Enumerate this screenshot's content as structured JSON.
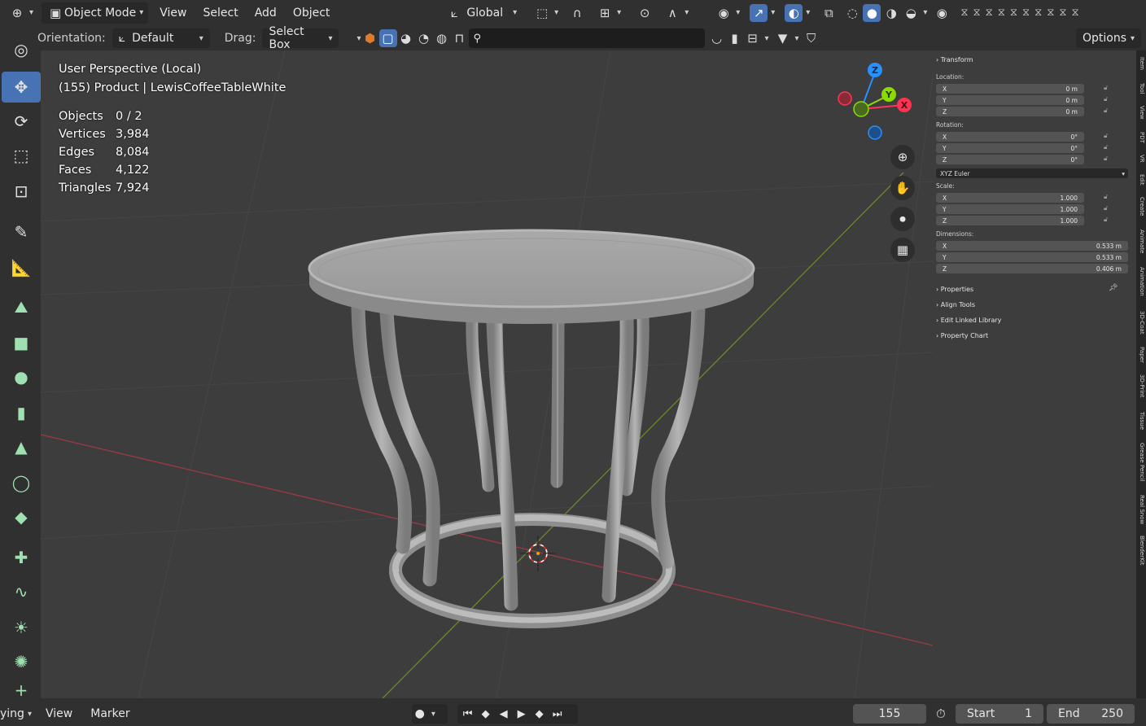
{
  "header": {
    "mode": "Object Mode",
    "menus": [
      "View",
      "Select",
      "Add",
      "Object"
    ],
    "transform_orientation": "Global"
  },
  "toolbar": {
    "orientation_label": "Orientation:",
    "orientation_value": "Default",
    "drag_label": "Drag:",
    "drag_value": "Select Box",
    "options_label": "Options"
  },
  "viewport": {
    "view_name": "User Perspective (Local)",
    "object_name": "(155) Product | LewisCoffeeTableWhite",
    "stats": [
      {
        "key": "Objects",
        "value": "0 / 2"
      },
      {
        "key": "Vertices",
        "value": "3,984"
      },
      {
        "key": "Edges",
        "value": "8,084"
      },
      {
        "key": "Faces",
        "value": "4,122"
      },
      {
        "key": "Triangles",
        "value": "7,924"
      }
    ],
    "gizmo_axes": {
      "z": "Z",
      "y": "Y",
      "x": "X"
    }
  },
  "npanel": {
    "transform_title": "Transform",
    "location_label": "Location:",
    "location": [
      {
        "axis": "X",
        "value": "0 m"
      },
      {
        "axis": "Y",
        "value": "0 m"
      },
      {
        "axis": "Z",
        "value": "0 m"
      }
    ],
    "rotation_label": "Rotation:",
    "rotation": [
      {
        "axis": "X",
        "value": "0°"
      },
      {
        "axis": "Y",
        "value": "0°"
      },
      {
        "axis": "Z",
        "value": "0°"
      }
    ],
    "rotation_mode": "XYZ Euler",
    "scale_label": "Scale:",
    "scale": [
      {
        "axis": "X",
        "value": "1.000"
      },
      {
        "axis": "Y",
        "value": "1.000"
      },
      {
        "axis": "Z",
        "value": "1.000"
      }
    ],
    "dimensions_label": "Dimensions:",
    "dimensions": [
      {
        "axis": "X",
        "value": "0.533 m"
      },
      {
        "axis": "Y",
        "value": "0.533 m"
      },
      {
        "axis": "Z",
        "value": "0.406 m"
      }
    ],
    "subpanels": [
      "Properties",
      "Align Tools",
      "Edit Linked Library",
      "Property Chart"
    ],
    "side_tabs": [
      "Item",
      "Tool",
      "View",
      "PDT",
      "VR",
      "Edit",
      "Create",
      "Animate",
      "Animation",
      "3D-Coat",
      "Paper",
      "3D-Print",
      "Tissue",
      "Grease Pencil",
      "Real Snow",
      "BlenderKit"
    ]
  },
  "timeline": {
    "mode_partial": "ying",
    "menus": [
      "View",
      "Marker"
    ],
    "current_frame": "155",
    "start_label": "Start",
    "start_value": "1",
    "end_label": "End",
    "end_value": "250"
  },
  "colors": {
    "accent": "#4772b3",
    "x_axis": "#ff3352",
    "y_axis": "#8bdc00",
    "z_axis": "#2890ff"
  }
}
